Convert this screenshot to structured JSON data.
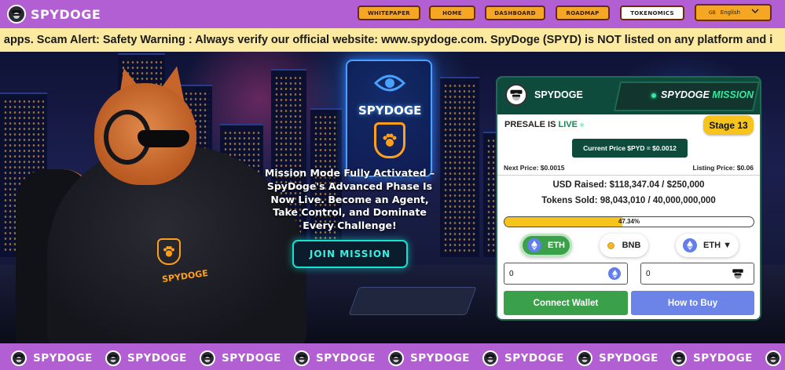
{
  "brand": {
    "name": "SPYDOGE"
  },
  "nav": {
    "whitepaper": "Whitepaper",
    "home": "Home",
    "dashboard": "Dashboard",
    "roadmap": "Roadmap",
    "tokenomics": "Tokenomics",
    "language_code": "GB",
    "language_label": "English"
  },
  "ticker": {
    "text": "g apps.   Scam Alert: Safety Warning : Always verify our official website: www.spydoge.com. SpyDoge (SPYD) is NOT listed on any platform and i"
  },
  "hero": {
    "sign_text": "SPYDOGE",
    "jacket_text": "SPYDOGE",
    "headline": "Mission Mode Fully Activated – SpyDoge's Advanced Phase Is Now Live. Become an Agent, Take Control, and Dominate Every Challenge!",
    "cta": "JOIN MISSION"
  },
  "presale": {
    "brand": "SPYDOGE",
    "mission_prefix": "SPYDOGE ",
    "mission_suffix": "MISSION",
    "status_prefix": "PRESALE IS ",
    "status_live": "LIVE",
    "stage": "Stage 13",
    "current_price": "Current Price $PYD = $0.0012",
    "next_price": "Next Price: $0.0015",
    "listing_price": "Listing Price: $0.06",
    "usd_raised": "USD Raised:  $118,347.04  / $250,000",
    "tokens_sold": "Tokens Sold: 98,043,010 / 40,000,000,000",
    "progress_percent": 47.34,
    "progress_label": "47.34%",
    "currencies": {
      "eth": "ETH",
      "bnb": "BNB",
      "eth_dropdown": "ETH ▼"
    },
    "pay_amount": "0",
    "receive_amount": "0",
    "connect_wallet": "Connect Wallet",
    "how_to_buy": "How to Buy"
  },
  "colors": {
    "nav_purple": "#b15fd2",
    "nav_button": "#f5a623",
    "ticker_bg": "#fbeaa0",
    "widget_green": "#0f4b3c",
    "stage_yellow": "#f7c41e",
    "connect_green": "#3aa14a",
    "how_blue": "#6c84e8",
    "cta_cyan": "#16e0d0"
  },
  "icons": {
    "logo": "spy-dog-logo-icon",
    "chevron": "chevron-down-icon",
    "eth": "ethereum-icon",
    "bnb": "bnb-icon"
  },
  "footer_band": {
    "text": "SPYDOGE"
  }
}
